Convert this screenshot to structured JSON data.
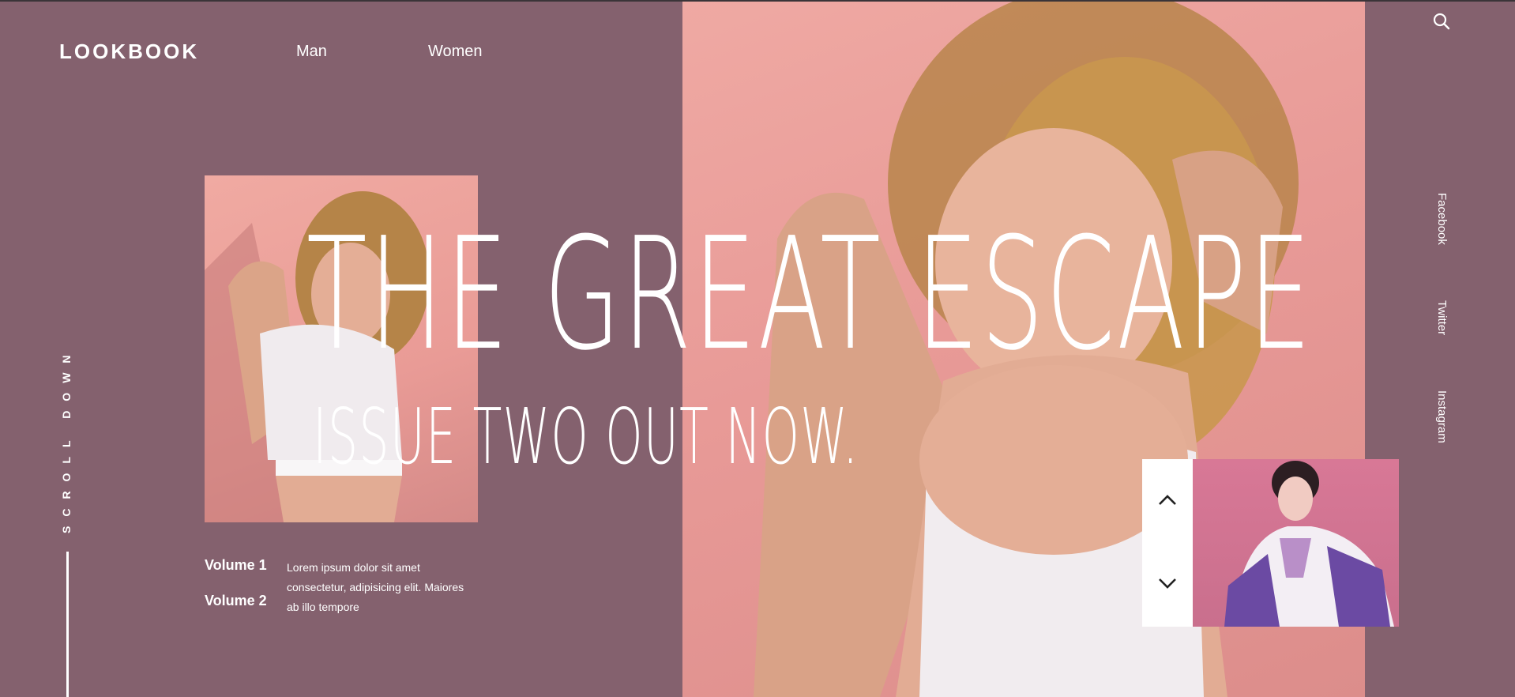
{
  "brand": "LOOKBOOK",
  "nav": {
    "man": "Man",
    "women": "Women"
  },
  "hero": {
    "title": "THE GREAT ESCAPE",
    "subtitle": "ISSUE TWO OUT NOW."
  },
  "scroll_label": "SCROLL DOWN",
  "volumes": [
    {
      "label": "Volume 1"
    },
    {
      "label": "Volume 2"
    }
  ],
  "description": "Lorem ipsum dolor sit amet consectetur, adipisicing elit. Maiores ab illo tempore",
  "social": {
    "facebook": "Facebook",
    "twitter": "Twitter",
    "instagram": "Instagram"
  },
  "icons": {
    "search": "search-icon",
    "up": "chevron-up-icon",
    "down": "chevron-down-icon"
  },
  "colors": {
    "background": "#84616e",
    "photo_bg": "#e89a97",
    "text": "#ffffff"
  }
}
